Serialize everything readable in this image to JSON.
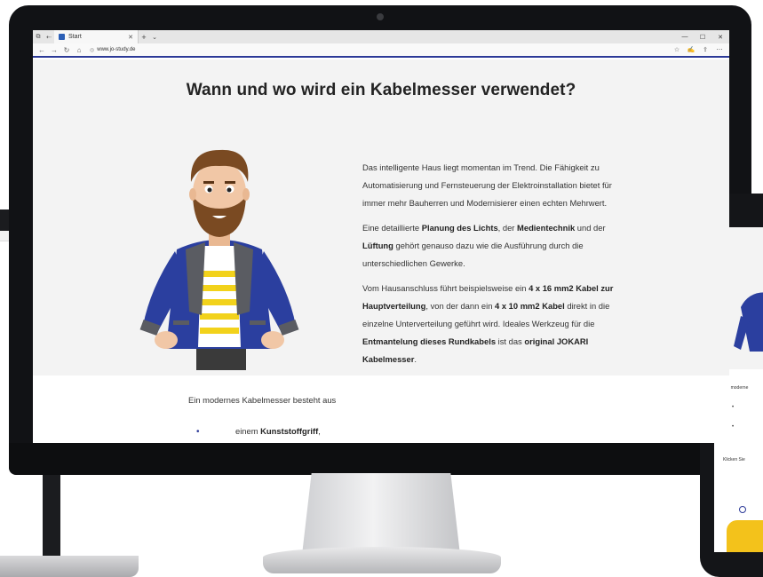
{
  "browser": {
    "tab_title": "Start",
    "url": "www.jo-study.de",
    "new_tab_glyph": "+",
    "close_tab_glyph": "✕",
    "window_controls": [
      "—",
      "☐",
      "✕"
    ]
  },
  "page": {
    "heading": "Wann und wo wird ein Kabelmesser verwendet?",
    "p1": "Das intelligente Haus liegt momentan im Trend. Die Fähigkeit zu Automatisierung und Fernsteuerung der Elektroinstallation bietet für immer mehr Bauherren und Modernisierer einen echten Mehrwert.",
    "p2": {
      "t1": "Eine detaillierte ",
      "b1": "Planung des Lichts",
      "t2": ", der ",
      "b2": "Medientechnik",
      "t3": " und der ",
      "b3": "Lüftung",
      "t4": " gehört genauso dazu wie die Ausführung durch die unterschiedlichen Gewerke."
    },
    "p3": {
      "t1": "Vom Hausanschluss führt beispielsweise ein ",
      "b1": "4 x 16 mm2 Kabel zur Hauptverteilung",
      "t2": ", von der dann ein ",
      "b2": "4 x 10 mm2  Kabel",
      "t3": " direkt in die einzelne Unterverteilung geführt wird. Ideales Werkzeug für die ",
      "b3": "Entmantelung dieses Rundkabels",
      "t4": " ist das ",
      "b4": "original JOKARI Kabelmesser",
      "t5": "."
    },
    "list_intro": "Ein modernes Kabelmesser besteht aus",
    "list_item": {
      "t1": "einem ",
      "b1": "Kunststoffgriff",
      "t2": ","
    }
  },
  "tablet": {
    "line1": "Ein moderne",
    "line2": "Klicken Sie"
  },
  "colors": {
    "accent": "#2c3a98",
    "hero_bg": "#f3f3f3",
    "jacket": "#2b3f9f",
    "shirt_stripe": "#f2d21b",
    "tool_yellow": "#f3c21b"
  }
}
